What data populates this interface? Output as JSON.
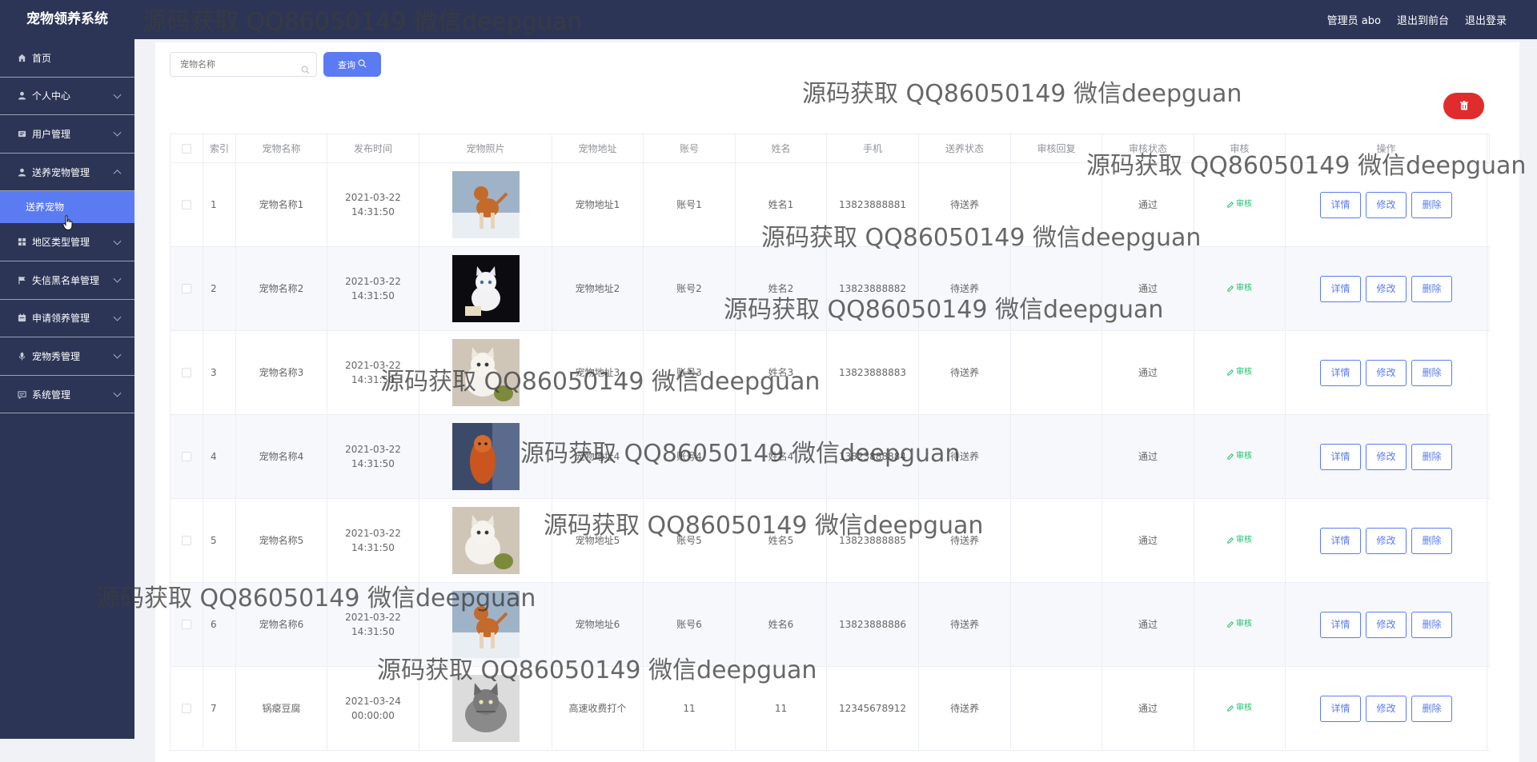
{
  "app": {
    "title": "宠物领养系统"
  },
  "header": {
    "admin_label": "管理员 abo",
    "front_link": "退出到前台",
    "logout_link": "退出登录"
  },
  "sidebar": {
    "items": [
      {
        "label": "首页",
        "icon": "home-icon"
      },
      {
        "label": "个人中心",
        "icon": "user-icon"
      },
      {
        "label": "用户管理",
        "icon": "users-icon"
      },
      {
        "label": "送养宠物管理",
        "icon": "user-icon",
        "sub": "送养宠物"
      },
      {
        "label": "地区类型管理",
        "icon": "grid-icon"
      },
      {
        "label": "失信黑名单管理",
        "icon": "flag-icon"
      },
      {
        "label": "申请领养管理",
        "icon": "calendar-icon"
      },
      {
        "label": "宠物秀管理",
        "icon": "mic-icon"
      },
      {
        "label": "系统管理",
        "icon": "message-icon"
      }
    ]
  },
  "search": {
    "placeholder": "宠物名称",
    "button": "查询"
  },
  "table": {
    "headers": [
      "索引",
      "宠物名称",
      "发布时间",
      "宠物照片",
      "宠物地址",
      "账号",
      "姓名",
      "手机",
      "送养状态",
      "审核回复",
      "审核状态",
      "审核",
      "操作"
    ],
    "audit_label": "审核",
    "op_labels": [
      "详情",
      "修改",
      "删除"
    ],
    "rows": [
      {
        "idx": "1",
        "name": "宠物名称1",
        "time": "2021-03-22 14:31:50",
        "addr": "宠物地址1",
        "account": "账号1",
        "person": "姓名1",
        "phone": "13823888881",
        "status": "待送养",
        "reply": "",
        "audit": "通过",
        "photo": "dog"
      },
      {
        "idx": "2",
        "name": "宠物名称2",
        "time": "2021-03-22 14:31:50",
        "addr": "宠物地址2",
        "account": "账号2",
        "person": "姓名2",
        "phone": "13823888882",
        "status": "待送养",
        "reply": "",
        "audit": "通过",
        "photo": "cat-white"
      },
      {
        "idx": "3",
        "name": "宠物名称3",
        "time": "2021-03-22 14:31:50",
        "addr": "宠物地址3",
        "account": "账号3",
        "person": "姓名3",
        "phone": "13823888883",
        "status": "待送养",
        "reply": "",
        "audit": "通过",
        "photo": "cat-toy"
      },
      {
        "idx": "4",
        "name": "宠物名称4",
        "time": "2021-03-22 14:31:50",
        "addr": "宠物地址4",
        "account": "账号4",
        "person": "姓名4",
        "phone": "13823888884",
        "status": "待送养",
        "reply": "",
        "audit": "通过",
        "photo": "dog-orange"
      },
      {
        "idx": "5",
        "name": "宠物名称5",
        "time": "2021-03-22 14:31:50",
        "addr": "宠物地址5",
        "account": "账号5",
        "person": "姓名5",
        "phone": "13823888885",
        "status": "待送养",
        "reply": "",
        "audit": "通过",
        "photo": "cat-toy"
      },
      {
        "idx": "6",
        "name": "宠物名称6",
        "time": "2021-03-22 14:31:50",
        "addr": "宠物地址6",
        "account": "账号6",
        "person": "姓名6",
        "phone": "13823888886",
        "status": "待送养",
        "reply": "",
        "audit": "通过",
        "photo": "dog"
      },
      {
        "idx": "7",
        "name": "锅瘪豆腐",
        "time": "2021-03-24 00:00:00",
        "addr": "高速收费打个",
        "account": "11",
        "person": "11",
        "phone": "12345678912",
        "status": "待送养",
        "reply": "",
        "audit": "通过",
        "photo": "cat-gray"
      }
    ]
  },
  "watermark": "源码获取 QQ86050149 微信deepguan",
  "colors": {
    "sidebar": "#2c3556",
    "accent": "#5b7bf2",
    "danger": "#e02c2c",
    "success": "#19be6b"
  }
}
